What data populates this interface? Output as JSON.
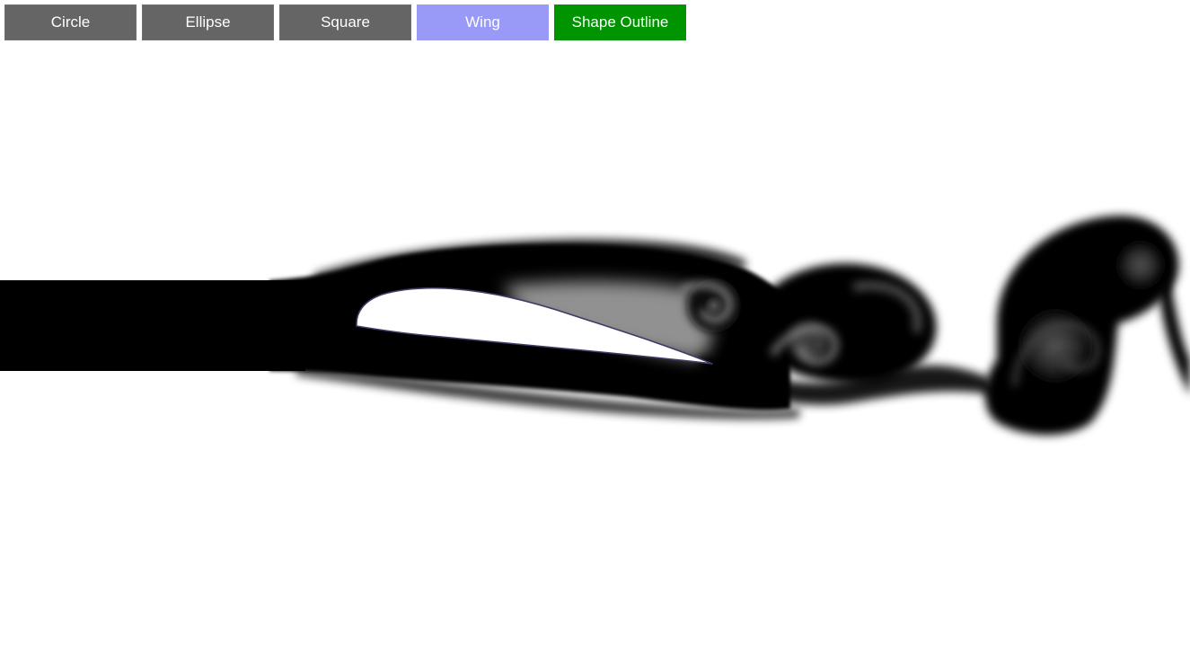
{
  "toolbar": {
    "buttons": [
      {
        "label": "Circle",
        "color": "#656565"
      },
      {
        "label": "Ellipse",
        "color": "#656565"
      },
      {
        "label": "Square",
        "color": "#656565"
      },
      {
        "label": "Wing",
        "color": "#9999f7",
        "selected": true
      },
      {
        "label": "Shape Outline",
        "color": "#009400",
        "active": true
      }
    ]
  },
  "simulation": {
    "selected_shape": "Wing",
    "shape_outline_enabled": true,
    "background_color": "#ffffff",
    "dye_color": "#000000",
    "obstacle_fill_color": "#ffffff",
    "obstacle_outline_color": "#3d3d66"
  }
}
